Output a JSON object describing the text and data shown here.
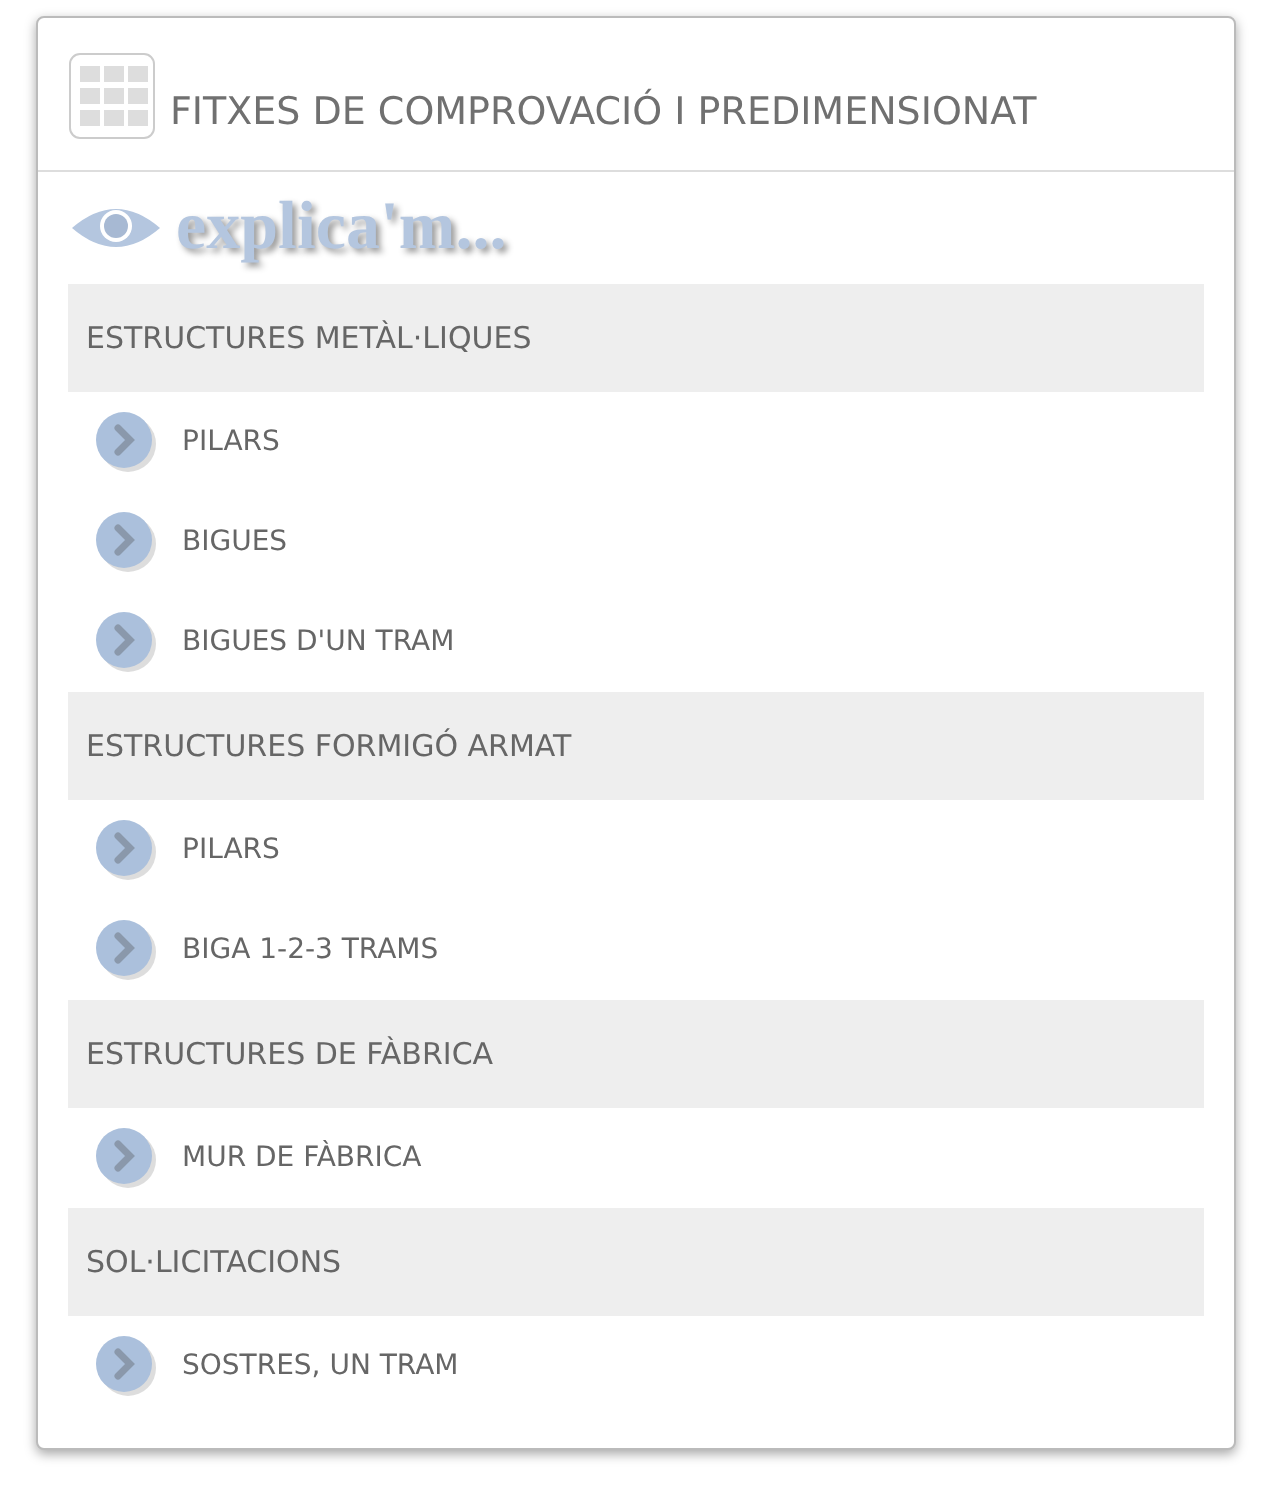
{
  "panel": {
    "title": "FITXES DE COMPROVACIÓ I PREDIMENSIONAT"
  },
  "banner": {
    "text": "explica'm..."
  },
  "sections": [
    {
      "title": "ESTRUCTURES METÀL·LIQUES",
      "items": [
        "PILARS",
        "BIGUES",
        "BIGUES D'UN TRAM"
      ]
    },
    {
      "title": "ESTRUCTURES FORMIGÓ ARMAT",
      "items": [
        "PILARS",
        "BIGA 1-2-3 TRAMS"
      ]
    },
    {
      "title": "ESTRUCTURES DE FÀBRICA",
      "items": [
        "MUR DE FÀBRICA"
      ]
    },
    {
      "title": "SOL·LICITACIONS",
      "items": [
        "SOSTRES, UN TRAM"
      ]
    }
  ]
}
